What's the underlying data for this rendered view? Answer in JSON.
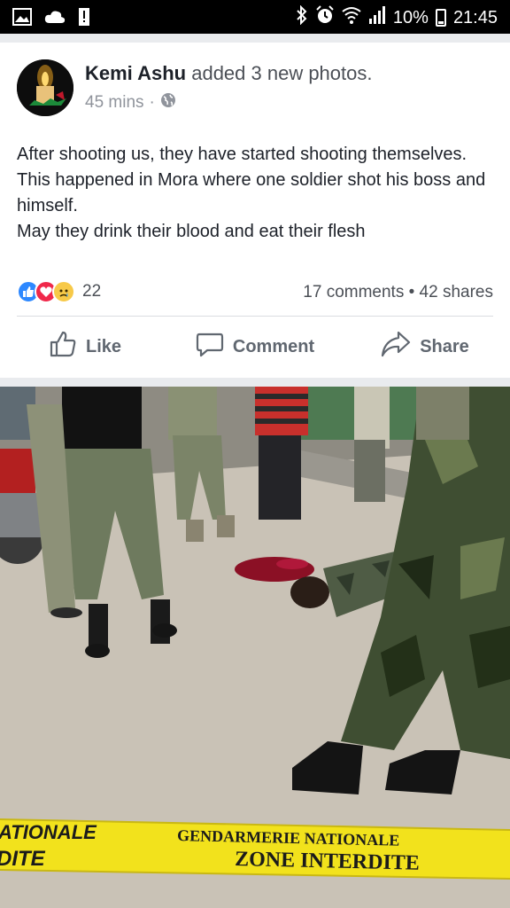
{
  "status_bar": {
    "battery": "10%",
    "time": "21:45"
  },
  "post": {
    "author": "Kemi Ashu",
    "action": "added 3 new photos.",
    "time_ago": "45 mins",
    "separator": "·",
    "privacy_icon": "globe-icon",
    "text_lines": [
      "After shooting us,  they have started shooting themselves.",
      "This happened in Mora where one soldier shot his boss and himself.",
      "May they drink their blood and eat their flesh"
    ],
    "reactions": [
      "like",
      "love",
      "sad"
    ],
    "reaction_count": "22",
    "comments": "17 comments",
    "shares": "42 shares",
    "dot": "•"
  },
  "actions": {
    "like": "Like",
    "comment": "Comment",
    "share": "Share"
  },
  "photo": {
    "tape_left_top": "ATIONALE",
    "tape_left_bottom": "DITE",
    "tape_right_top": "GENDARMERIE NATIONALE",
    "tape_right_bottom": "ZONE INTERDITE"
  },
  "colors": {
    "accent": "#2d88ff",
    "love": "#f0284a",
    "tape": "#f2e21c"
  }
}
